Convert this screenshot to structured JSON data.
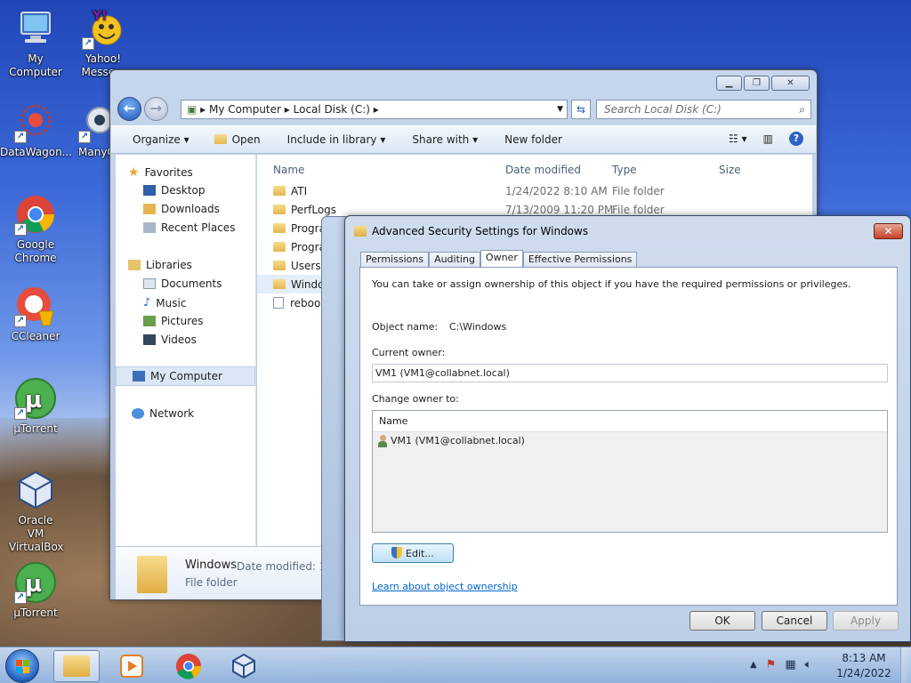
{
  "desktop": {
    "icons": [
      {
        "label": "My Computer",
        "name": "desktop-icon-my-computer"
      },
      {
        "label": "Yahoo! Messe...",
        "name": "desktop-icon-yahoo-messenger"
      },
      {
        "label": "DataWagon...",
        "name": "desktop-icon-datawagon"
      },
      {
        "label": "ManyC...",
        "name": "desktop-icon-manycam"
      },
      {
        "label": "Google Chrome",
        "name": "desktop-icon-google-chrome"
      },
      {
        "label": "CCleaner",
        "name": "desktop-icon-ccleaner"
      },
      {
        "label": "µTorrent",
        "name": "desktop-icon-utorrent"
      },
      {
        "label": "Oracle VM VirtualBox",
        "name": "desktop-icon-virtualbox"
      },
      {
        "label": "µTorrent",
        "name": "desktop-icon-utorrent-2"
      }
    ]
  },
  "explorer": {
    "address_parts": [
      "My Computer",
      "Local Disk (C:)"
    ],
    "search_placeholder": "Search Local Disk (C:)",
    "toolbar": {
      "organize": "Organize",
      "open": "Open",
      "include_in_library": "Include in library",
      "share_with": "Share with",
      "new_folder": "New folder"
    },
    "nav": {
      "favorites": "Favorites",
      "desktop": "Desktop",
      "downloads": "Downloads",
      "recent_places": "Recent Places",
      "libraries": "Libraries",
      "documents": "Documents",
      "music": "Music",
      "pictures": "Pictures",
      "videos": "Videos",
      "my_computer": "My Computer",
      "network": "Network"
    },
    "columns": {
      "name": "Name",
      "date_modified": "Date modified",
      "type": "Type",
      "size": "Size"
    },
    "files": [
      {
        "name": "ATI",
        "date": "1/24/2022 8:10 AM",
        "type": "File folder"
      },
      {
        "name": "PerfLogs",
        "date": "7/13/2009 11:20 PM",
        "type": "File folder"
      },
      {
        "name": "Progra",
        "date": "",
        "type": ""
      },
      {
        "name": "Progra",
        "date": "",
        "type": ""
      },
      {
        "name": "Users",
        "date": "",
        "type": ""
      },
      {
        "name": "Windo",
        "date": "",
        "type": ""
      },
      {
        "name": "reboo",
        "date": "",
        "type": ""
      }
    ],
    "details": {
      "name": "Windows",
      "date_label": "Date modified: 1/",
      "type": "File folder"
    }
  },
  "dialog": {
    "title": "Advanced Security Settings for Windows",
    "tabs": [
      "Permissions",
      "Auditing",
      "Owner",
      "Effective Permissions"
    ],
    "active_tab": "Owner",
    "intro": "You can take or assign ownership of this object if you have the required permissions or privileges.",
    "object_name_label": "Object name:",
    "object_name_value": "C:\\Windows",
    "current_owner_label": "Current owner:",
    "current_owner_value": "VM1 (VM1@collabnet.local)",
    "change_owner_label": "Change owner to:",
    "list_header": "Name",
    "list_items": [
      "VM1 (VM1@collabnet.local)"
    ],
    "edit_button": "Edit...",
    "learn_link": "Learn about object ownership",
    "ok": "OK",
    "cancel": "Cancel",
    "apply": "Apply"
  },
  "taskbar": {
    "time": "8:13 AM",
    "date": "1/24/2022"
  }
}
